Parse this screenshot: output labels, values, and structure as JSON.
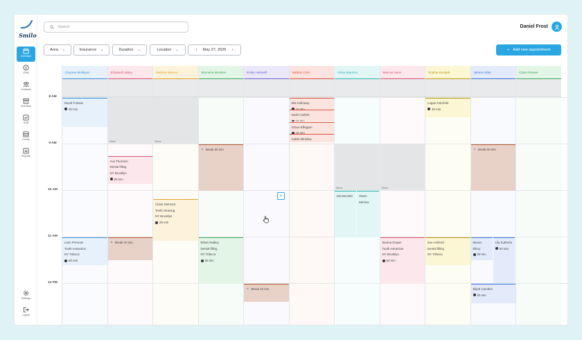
{
  "app": {
    "logo": "Smilo",
    "user_name": "Daniel Frost"
  },
  "sidebar": {
    "items": [
      {
        "label": "Schedule",
        "icon": "calendar-icon",
        "active": true
      },
      {
        "label": "CRM",
        "icon": "dollar-circle-icon",
        "active": false
      },
      {
        "label": "Contacts",
        "icon": "contacts-icon",
        "active": false
      },
      {
        "label": "Inventory",
        "icon": "box-icon",
        "active": false
      },
      {
        "label": "VOB",
        "icon": "checkbox-icon",
        "active": false
      },
      {
        "label": "Forms",
        "icon": "form-icon",
        "active": false
      },
      {
        "label": "Reports",
        "icon": "chart-icon",
        "active": false
      }
    ],
    "bottom_items": [
      {
        "label": "Settings",
        "icon": "gear-icon"
      },
      {
        "label": "Logout",
        "icon": "logout-icon"
      }
    ]
  },
  "search": {
    "placeholder": "Search"
  },
  "filters": {
    "area": "Area",
    "insurance": "Insurance",
    "duration": "Duration",
    "location": "Location",
    "date": "May 27, 2025"
  },
  "add_button": "Add new appointment",
  "times": [
    "8 AM",
    "9 AM",
    "10 AM",
    "11 AM",
    "12 PM"
  ],
  "doctors": [
    {
      "name": "Gayane Melikyan",
      "color": "#3b8fd6",
      "bg": "#e6f1fb"
    },
    {
      "name": "Elizabeth Wiley",
      "color": "#d64f72",
      "bg": "#fce7ec"
    },
    {
      "name": "Melanie Barnes",
      "color": "#e0a22a",
      "bg": "#fdf3dc"
    },
    {
      "name": "Momena Morales",
      "color": "#3da85a",
      "bg": "#e3f5e7"
    },
    {
      "name": "Emily Hartwell",
      "color": "#6b5fd0",
      "bg": "#ebe8fb"
    },
    {
      "name": "Nathan Cole",
      "color": "#d6533e",
      "bg": "#fbe4df"
    },
    {
      "name": "Olivia Marston",
      "color": "#2bb5b0",
      "bg": "#e1f6f5"
    },
    {
      "name": "Marcus Vane",
      "color": "#d64f72",
      "bg": "#fce7ec"
    },
    {
      "name": "Sophia Kendall",
      "color": "#b59a12",
      "bg": "#fbf6d4"
    },
    {
      "name": "James Alder",
      "color": "#3b6fd6",
      "bg": "#e3ebfb"
    },
    {
      "name": "Claire Rowen",
      "color": "#3da85a",
      "bg": "#e3f5e7"
    }
  ],
  "labels": {
    "starts": "Starts"
  },
  "appointments": {
    "a1": {
      "name": "David Fulman",
      "duration": "30 min"
    },
    "a2": {
      "name": "Mia Holloway",
      "duration": "15 min"
    },
    "a3": {
      "name": "Noah Carlisle",
      "duration": "15 min"
    },
    "a4": {
      "name": "Grace Ellington",
      "duration": "15 min"
    },
    "a5": {
      "name": "Caleb Winslow"
    },
    "a6": {
      "name": "Logan Fairchild",
      "duration": "30 min"
    },
    "a7": {
      "name": "Ava Thornton",
      "procedure": "Dental filling",
      "location": "NY Brooklyn",
      "duration": "30 min"
    },
    "a8": {
      "name": "Break 60 min"
    },
    "a9": {
      "name": "Break 60 min"
    },
    "a10": {
      "name": "Chloe Delmont",
      "procedure": "Teeth cleaning",
      "location": "NY Brooklyn",
      "duration": "45 min"
    },
    "a11": {
      "name": "Isla Beckett"
    },
    "a12": {
      "name": "Owen Merlow"
    },
    "a13": {
      "name": "Liam Prescott",
      "procedure": "Tooth extraction",
      "location": "NY Tribeca",
      "duration": "60 min"
    },
    "a14": {
      "name": "Break 20 min"
    },
    "a15": {
      "name": "Ethan Radley",
      "procedure": "Dental filling",
      "location": "NY Tribeca",
      "duration": "60 min"
    },
    "a16": {
      "name": "Sienna Draper",
      "procedure": "Tooth extraction",
      "location": "NY Brooklyn",
      "duration": "60 min"
    },
    "a17": {
      "name": "Zoe Ashford",
      "procedure": "Dental filling",
      "location": "NY Tribeca"
    },
    "a18": {
      "name": "Mason Ellery",
      "duration": "30 min"
    },
    "a19": {
      "name": "Lily Sutherla",
      "duration": "60 min"
    },
    "a20": {
      "name": "Break 40 min"
    },
    "a21": {
      "name": "Elijah Camden",
      "duration": "30 min"
    }
  }
}
